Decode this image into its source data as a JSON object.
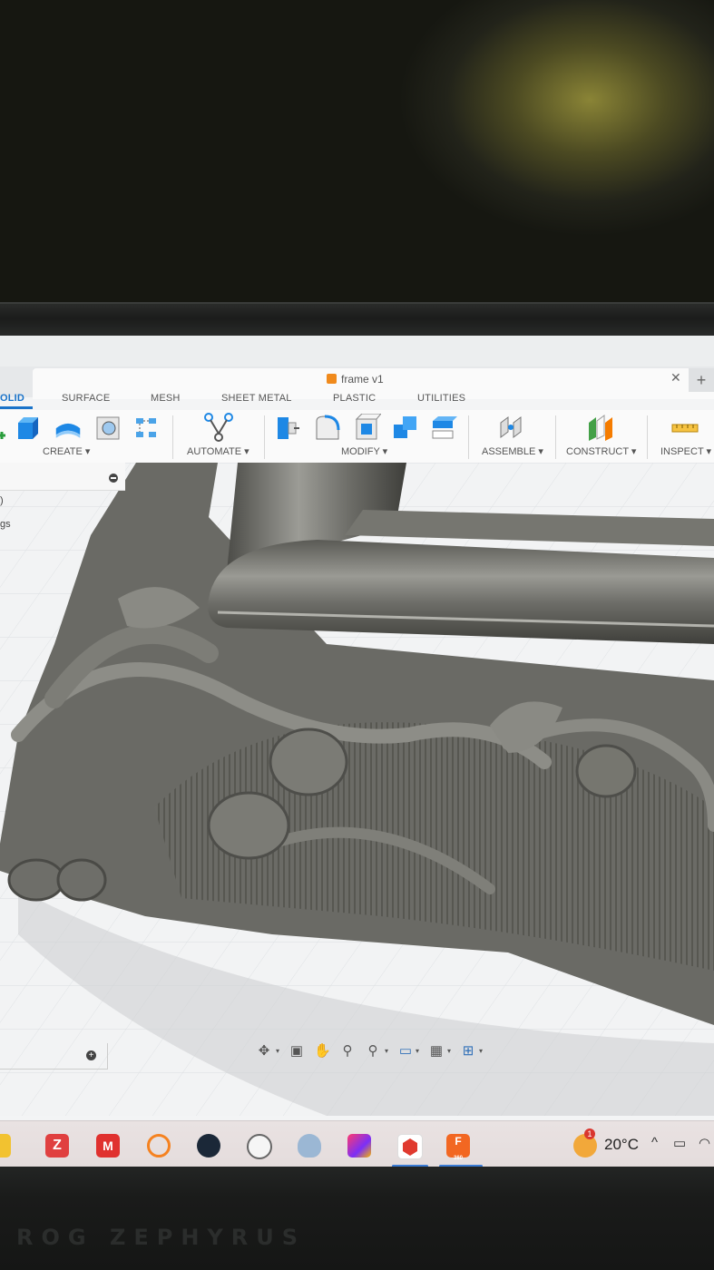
{
  "hardware": {
    "brand": "ROG ZEPHYRUS"
  },
  "document": {
    "title": "frame v1"
  },
  "workspace_tabs": [
    "OLID",
    "SURFACE",
    "MESH",
    "SHEET METAL",
    "PLASTIC",
    "UTILITIES"
  ],
  "toolbar": {
    "groups": [
      "CREATE ▾",
      "AUTOMATE ▾",
      "MODIFY ▾",
      "ASSEMBLE ▾",
      "CONSTRUCT ▾",
      "INSPECT ▾"
    ]
  },
  "browser": {
    "line1": ")",
    "line2": "gs"
  },
  "taskbar": {
    "temperature": "20°C",
    "notification_count": "1",
    "fusion_label": "F",
    "fusion_sub": "360"
  },
  "colors": {
    "accent": "#1a73c9",
    "model": "#6d6d68",
    "canvas": "#f3f4f5"
  },
  "icons": [
    "undo-icon",
    "close-icon",
    "new-tab-icon",
    "orbit-icon",
    "look-at-icon",
    "pan-icon",
    "zoom-icon",
    "fit-icon",
    "display-settings-icon",
    "grid-icon",
    "viewports-icon"
  ]
}
